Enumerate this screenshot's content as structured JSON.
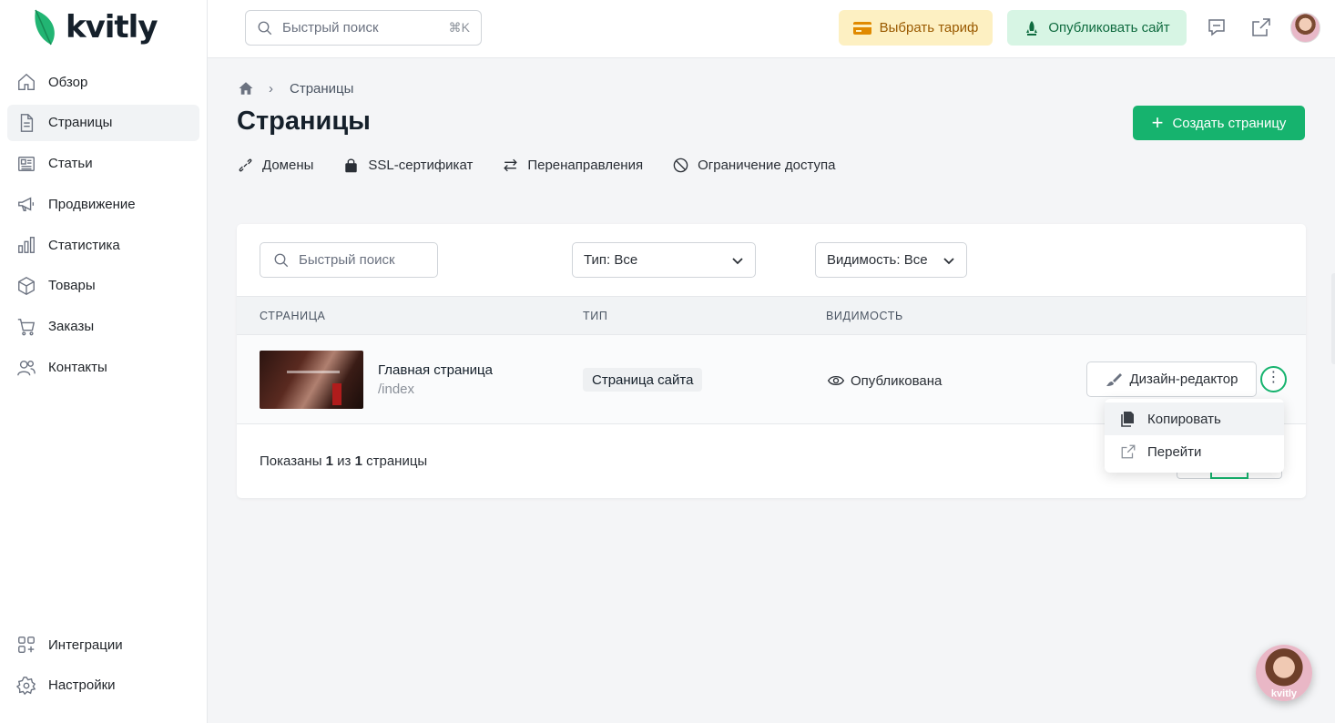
{
  "brand": {
    "name": "kvitly"
  },
  "sidebar": {
    "items": [
      {
        "label": "Обзор",
        "icon": "home-icon"
      },
      {
        "label": "Страницы",
        "icon": "document-icon",
        "active": true
      },
      {
        "label": "Статьи",
        "icon": "newspaper-icon"
      },
      {
        "label": "Продвижение",
        "icon": "megaphone-icon"
      },
      {
        "label": "Статистика",
        "icon": "bar-chart-icon"
      },
      {
        "label": "Товары",
        "icon": "box-icon"
      },
      {
        "label": "Заказы",
        "icon": "cart-icon"
      },
      {
        "label": "Контакты",
        "icon": "users-icon"
      }
    ],
    "bottom_items": [
      {
        "label": "Интеграции",
        "icon": "integrations-icon"
      },
      {
        "label": "Настройки",
        "icon": "gear-icon"
      }
    ]
  },
  "topbar": {
    "search_placeholder": "Быстрый поиск",
    "search_shortcut": "⌘K",
    "tariff_label": "Выбрать тариф",
    "publish_label": "Опубликовать сайт"
  },
  "breadcrumb": {
    "current": "Страницы"
  },
  "page": {
    "title": "Страницы",
    "create_label": "Создать страницу"
  },
  "subnav": [
    {
      "label": "Домены",
      "icon": "link-icon"
    },
    {
      "label": "SSL-сертификат",
      "icon": "lock-icon"
    },
    {
      "label": "Перенаправления",
      "icon": "redirect-icon"
    },
    {
      "label": "Ограничение доступа",
      "icon": "block-icon"
    }
  ],
  "filters": {
    "search_placeholder": "Быстрый поиск",
    "type_label": "Тип: Все",
    "visibility_label": "Видимость: Все"
  },
  "table": {
    "columns": [
      "СТРАНИЦА",
      "ТИП",
      "ВИДИМОСТЬ"
    ],
    "rows": [
      {
        "title": "Главная страница",
        "path": "/index",
        "type": "Страница сайта",
        "visibility": "Опубликована",
        "editor_label": "Дизайн-редактор"
      }
    ],
    "footer_prefix": "Показаны ",
    "footer_shown": "1",
    "footer_mid": " из ",
    "footer_total": "1",
    "footer_suffix": " страницы"
  },
  "dropdown": {
    "items": [
      {
        "label": "Копировать",
        "icon": "copy-icon"
      },
      {
        "label": "Перейти",
        "icon": "external-link-icon"
      }
    ]
  },
  "chat": {
    "label": "kvitly"
  },
  "colors": {
    "accent": "#16b36e",
    "tariff_bg": "#fdf0c2",
    "publish_bg": "#d7f5e4"
  }
}
